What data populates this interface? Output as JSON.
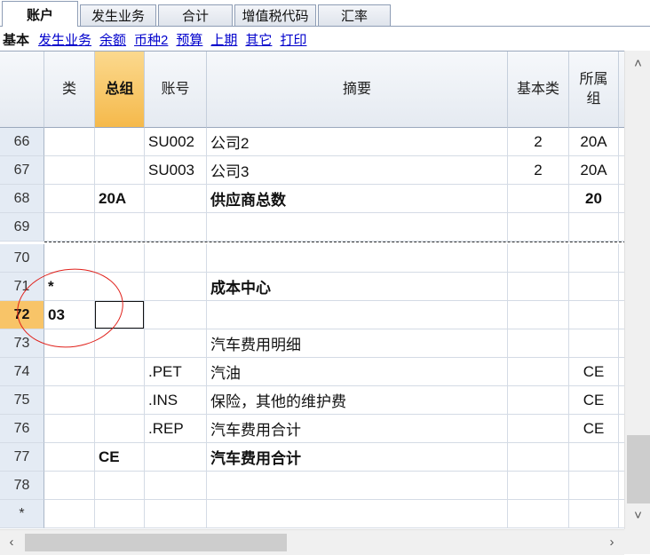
{
  "tabs": [
    {
      "label": "账户",
      "active": true
    },
    {
      "label": "发生业务",
      "active": false
    },
    {
      "label": "合计",
      "active": false
    },
    {
      "label": "增值税代码",
      "active": false
    },
    {
      "label": "汇率",
      "active": false
    }
  ],
  "subnav": {
    "current": "基本",
    "links": [
      "发生业务",
      "余额",
      "币种2",
      "预算",
      "上期",
      "其它",
      "打印"
    ]
  },
  "columns": {
    "class": "类",
    "group": "总组",
    "account": "账号",
    "description": "摘要",
    "bclass": "基本类",
    "gr1": "所属组"
  },
  "rows": [
    {
      "num": "66",
      "class": "",
      "group": "",
      "account": "SU002",
      "description": "公司2",
      "bclass": "2",
      "gr1": "20A",
      "bold": false
    },
    {
      "num": "67",
      "class": "",
      "group": "",
      "account": "SU003",
      "description": "公司3",
      "bclass": "2",
      "gr1": "20A",
      "bold": false
    },
    {
      "num": "68",
      "class": "",
      "group": "20A",
      "account": "",
      "description": "供应商总数",
      "bclass": "",
      "gr1": "20",
      "bold": true
    },
    {
      "num": "69",
      "class": "",
      "group": "",
      "account": "",
      "description": "",
      "bclass": "",
      "gr1": "",
      "bold": false
    },
    {
      "num": "70",
      "class": "",
      "group": "",
      "account": "",
      "description": "",
      "bclass": "",
      "gr1": "",
      "bold": false
    },
    {
      "num": "71",
      "class": "*",
      "group": "",
      "account": "",
      "description": "成本中心",
      "bclass": "",
      "gr1": "",
      "bold": true
    },
    {
      "num": "72",
      "class": "03",
      "group": "",
      "account": "",
      "description": "",
      "bclass": "",
      "gr1": "",
      "bold": true,
      "current": true
    },
    {
      "num": "73",
      "class": "",
      "group": "",
      "account": "",
      "description": "汽车费用明细",
      "bclass": "",
      "gr1": "",
      "bold": false
    },
    {
      "num": "74",
      "class": "",
      "group": "",
      "account": ".PET",
      "description": "汽油",
      "bclass": "",
      "gr1": "CE",
      "bold": false
    },
    {
      "num": "75",
      "class": "",
      "group": "",
      "account": ".INS",
      "description": "保险，其他的维护费",
      "bclass": "",
      "gr1": "CE",
      "bold": false
    },
    {
      "num": "76",
      "class": "",
      "group": "",
      "account": ".REP",
      "description": "汽车费用合计",
      "bclass": "",
      "gr1": "CE",
      "bold": false
    },
    {
      "num": "77",
      "class": "",
      "group": "CE",
      "account": "",
      "description": "汽车费用合计",
      "bclass": "",
      "gr1": "",
      "bold": true
    },
    {
      "num": "78",
      "class": "",
      "group": "",
      "account": "",
      "description": "",
      "bclass": "",
      "gr1": "",
      "bold": false
    },
    {
      "num": "*",
      "class": "",
      "group": "",
      "account": "",
      "description": "",
      "bclass": "",
      "gr1": "",
      "bold": false
    }
  ],
  "scroll": {
    "up": "^",
    "down": "v",
    "left": "<",
    "right": ">"
  },
  "colors": {
    "selected_header": "#f5b94b",
    "annotation_circle": "#e0201a",
    "link": "#0000cc"
  }
}
